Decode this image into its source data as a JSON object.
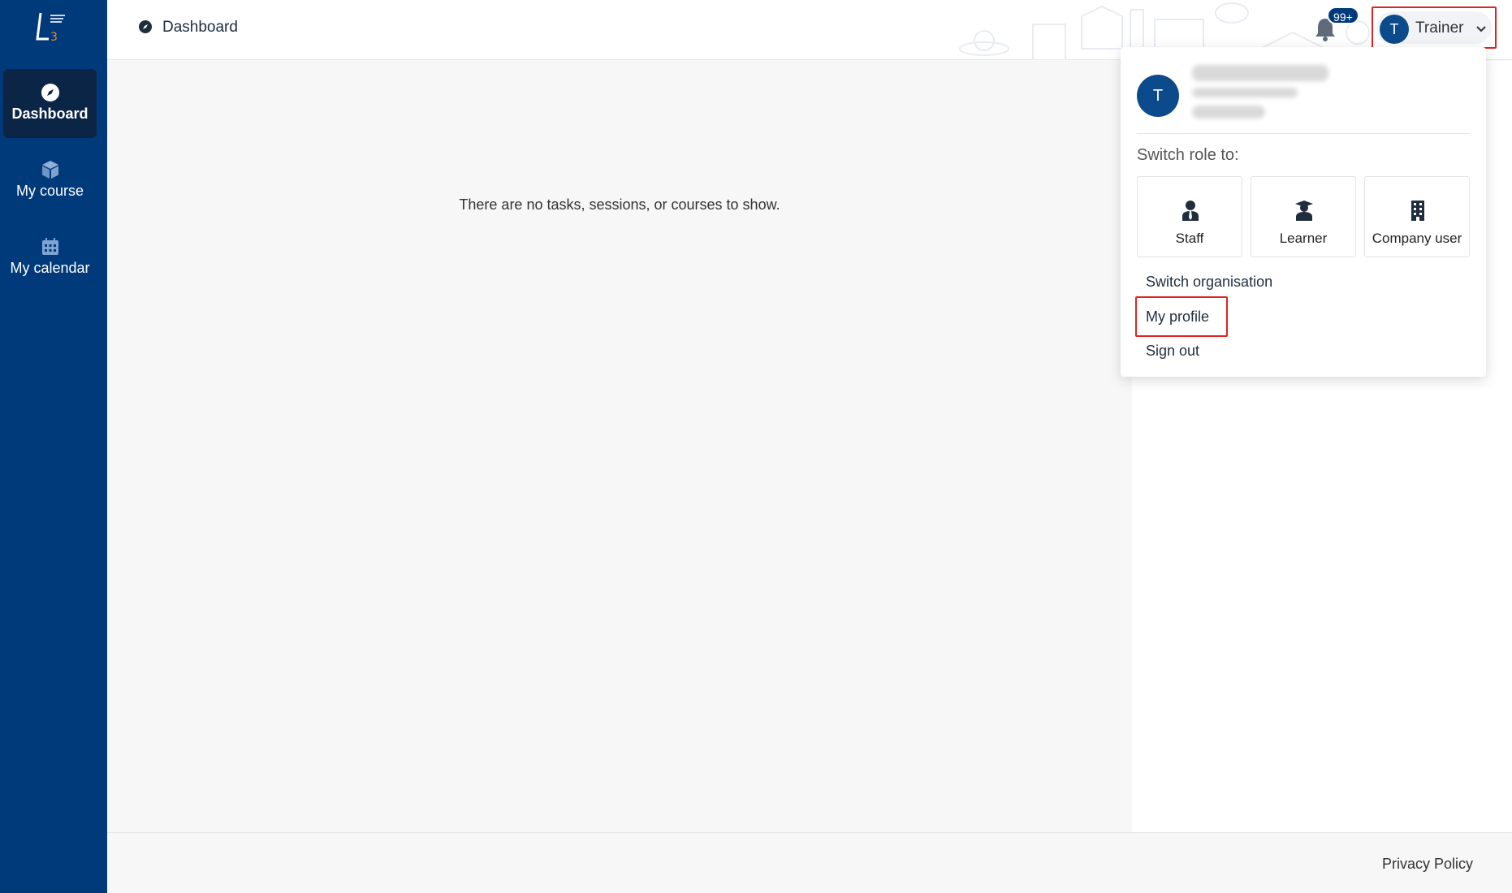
{
  "sidebar": {
    "items": [
      {
        "label": "Dashboard",
        "icon": "compass-icon",
        "active": true
      },
      {
        "label": "My course",
        "icon": "cube-icon",
        "active": false
      },
      {
        "label": "My calendar",
        "icon": "calendar-icon",
        "active": false
      }
    ]
  },
  "header": {
    "breadcrumb": "Dashboard",
    "notifications_badge": "99+",
    "user": {
      "initial": "T",
      "role": "Trainer"
    }
  },
  "main": {
    "empty_message": "There are no tasks, sessions, or courses to show."
  },
  "dropdown": {
    "avatar_initial": "T",
    "switch_role_title": "Switch role to:",
    "roles": [
      {
        "label": "Staff",
        "icon": "staff-icon"
      },
      {
        "label": "Learner",
        "icon": "graduate-icon"
      },
      {
        "label": "Company user",
        "icon": "building-icon"
      }
    ],
    "links": {
      "switch_org": "Switch organisation",
      "my_profile": "My profile",
      "sign_out": "Sign out"
    }
  },
  "footer": {
    "privacy": "Privacy Policy"
  },
  "colors": {
    "sidebar": "#003a7a",
    "sidebar_active": "#0b2547",
    "accent": "#0b4a8b",
    "highlight": "#e02424"
  }
}
